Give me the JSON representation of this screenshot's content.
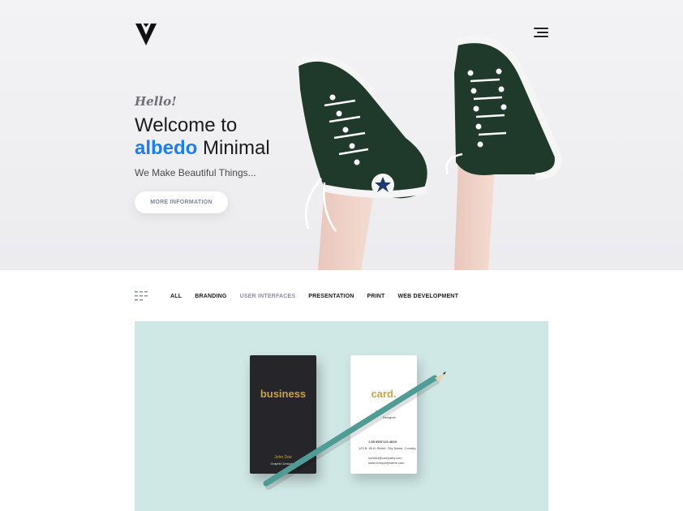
{
  "brand": {
    "logo_icon": "albedo-v-logo-icon"
  },
  "header": {
    "menu_icon": "hamburger-menu-icon"
  },
  "hero": {
    "greeting": "Hello!",
    "title_line1": "Welcome to",
    "title_accent": "albedo",
    "title_line2_rest": " Minimal",
    "tagline": "We Make Beautiful Things...",
    "button_label": "MORE INFORMATION",
    "accent_color": "#1a7ef2"
  },
  "filters": {
    "icon": "grid-icon",
    "items": [
      {
        "label": "ALL",
        "active": false
      },
      {
        "label": "BRANDING",
        "active": false
      },
      {
        "label": "USER INTERFACES",
        "active": true
      },
      {
        "label": "PRESENTATION",
        "active": false
      },
      {
        "label": "PRINT",
        "active": false
      },
      {
        "label": "WEB DEVELOPMENT",
        "active": false
      }
    ]
  },
  "portfolio": {
    "card_dark": {
      "title": "business",
      "name": "John Doe",
      "role": "Graphic Designer"
    },
    "card_light": {
      "title": "card.",
      "name": "John",
      "role": "Designer",
      "phone": "1-55 8557123 48XX",
      "address": "123 B, 60 th Street, City Name, Country",
      "email": "contact@company.com",
      "website": "www.companyname.com"
    },
    "background_color": "#cfe7e5"
  }
}
